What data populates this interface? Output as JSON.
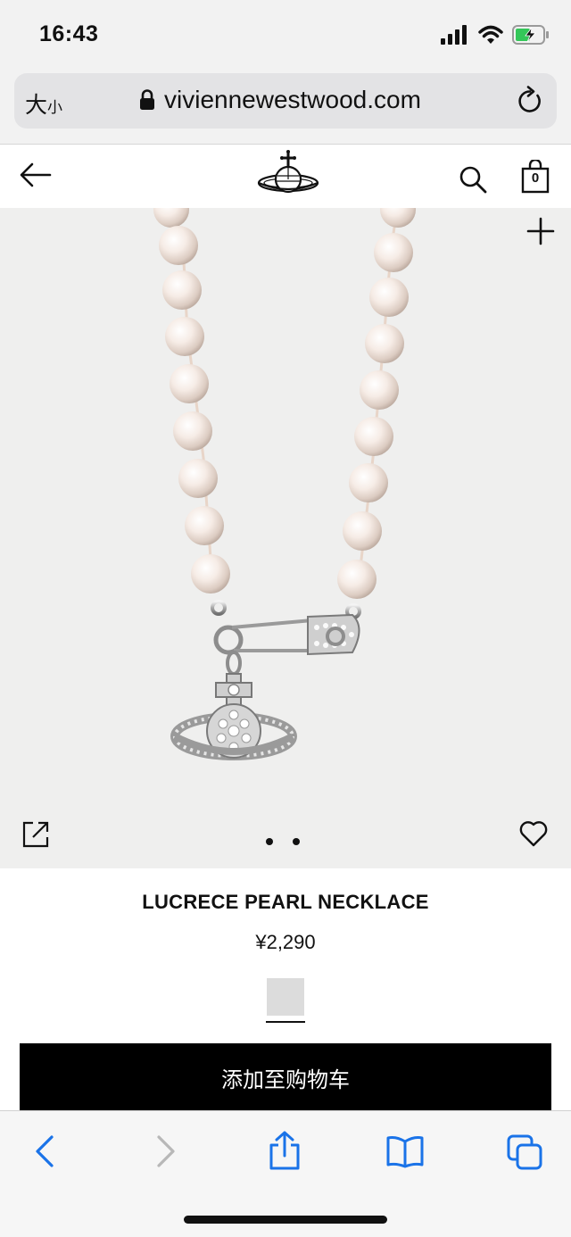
{
  "status_bar": {
    "time": "16:43"
  },
  "browser": {
    "text_size_label_big": "大",
    "text_size_label_small": "小",
    "url": "viviennewestwood.com"
  },
  "header": {
    "bag_count": "0"
  },
  "gallery": {
    "page_count": 2
  },
  "product": {
    "name": "LUCRECE PEARL NECKLACE",
    "price": "¥2,290",
    "add_to_cart_label": "添加至购物车"
  },
  "colors": {
    "image_background": "#efefee",
    "cta_background": "#000000",
    "link_blue": "#1a73e8",
    "battery_green": "#34c759"
  }
}
